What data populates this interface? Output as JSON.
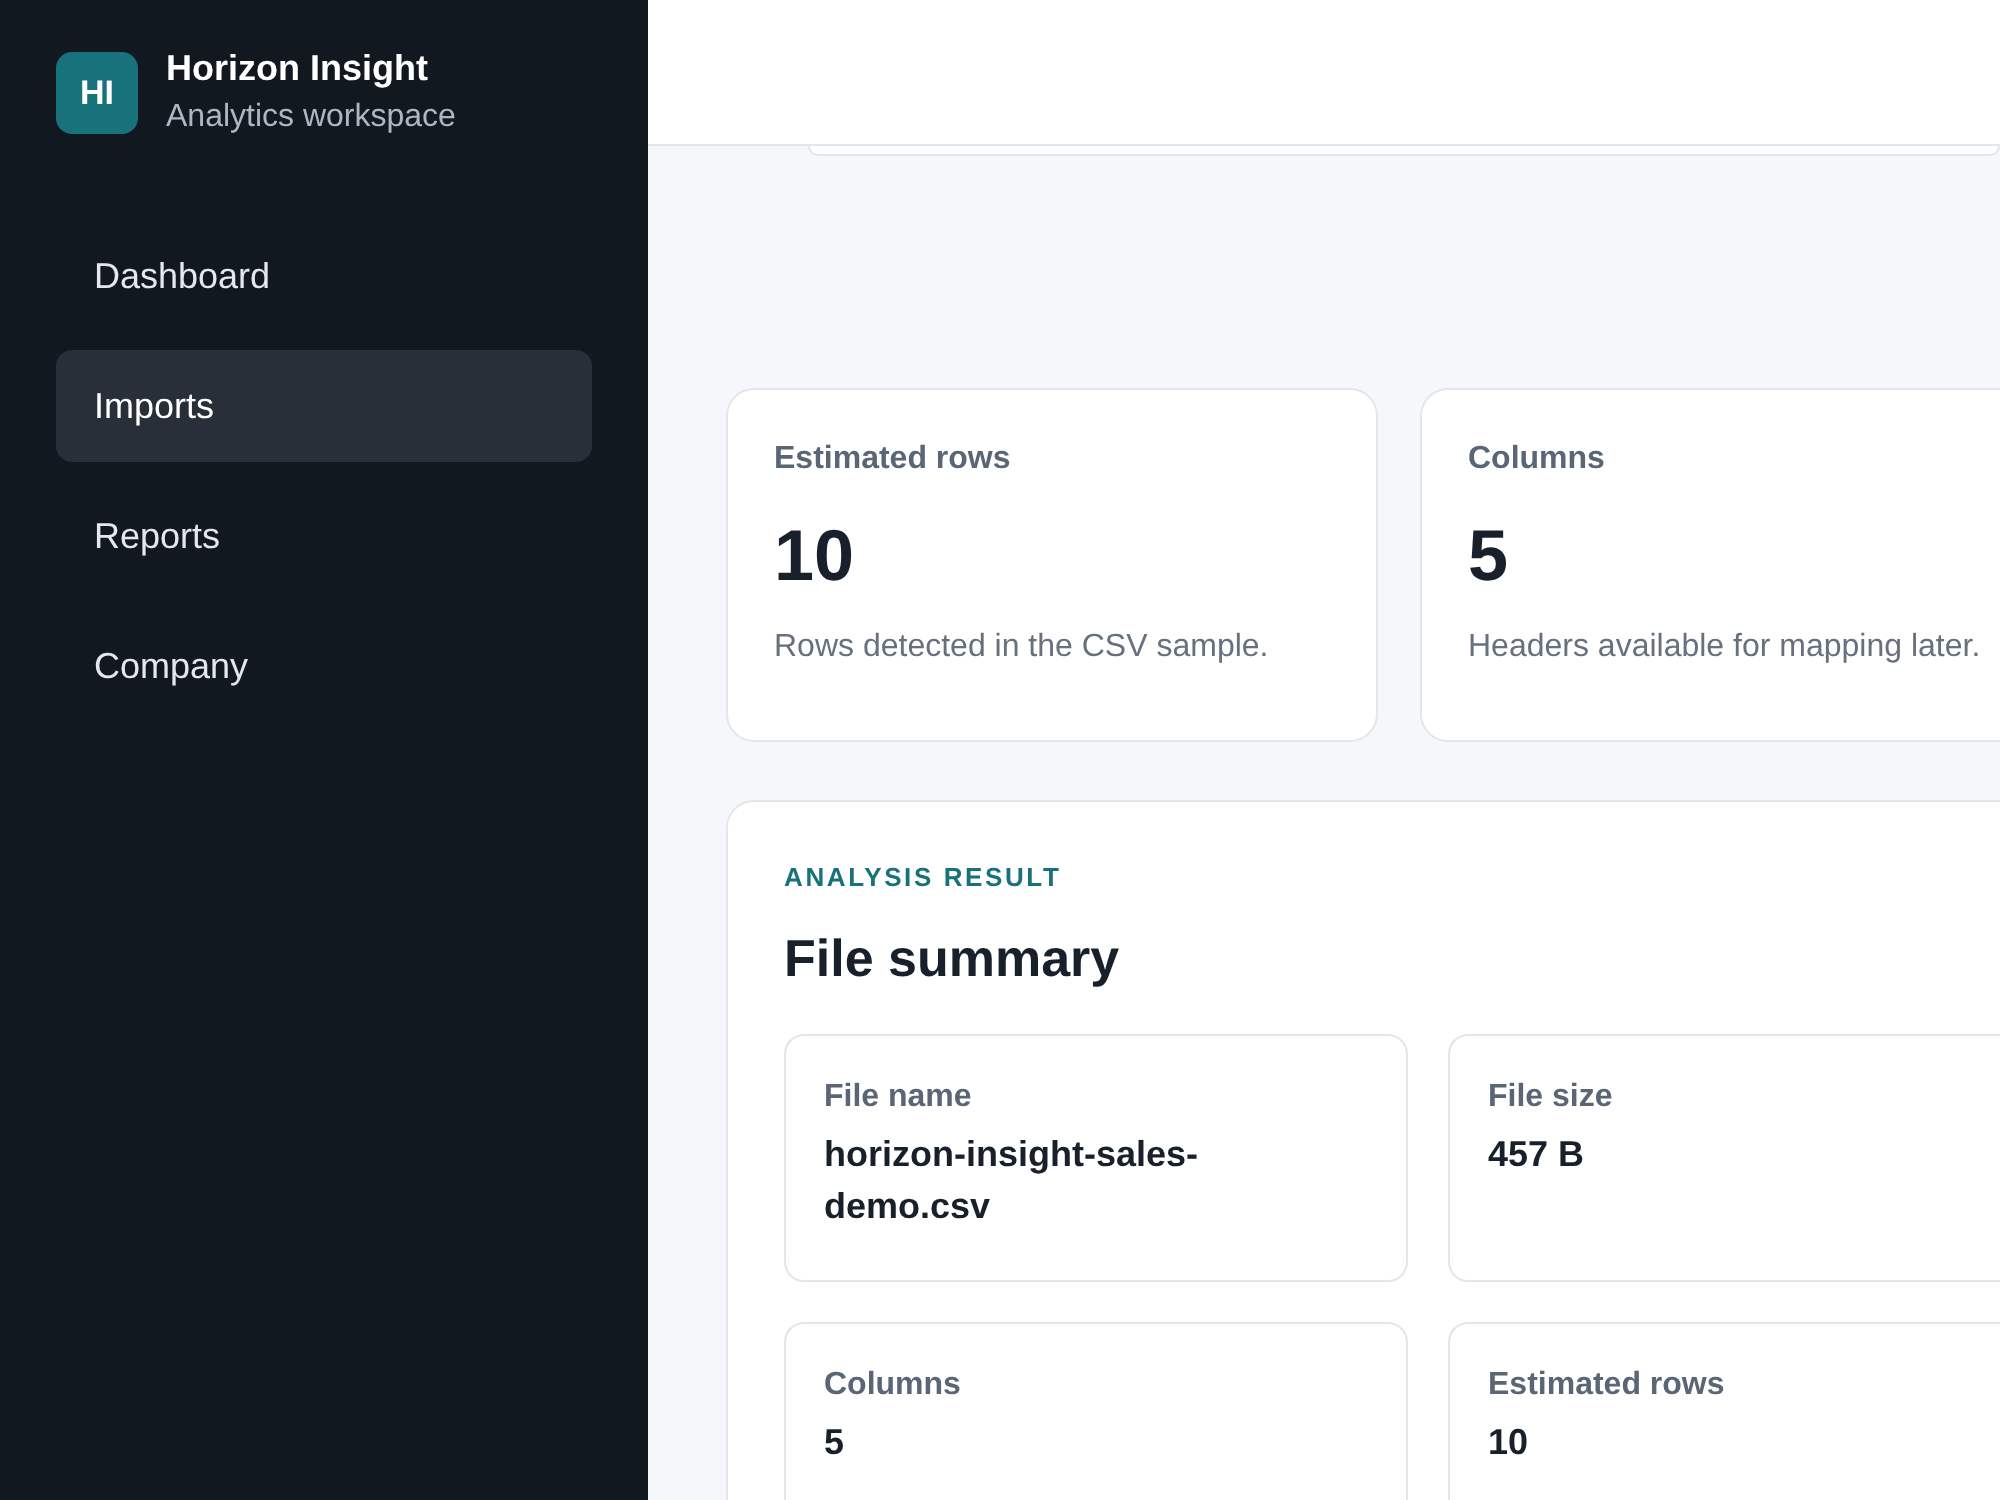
{
  "brand": {
    "logo": "HI",
    "name": "Horizon Insight",
    "subtitle": "Analytics workspace"
  },
  "nav": [
    {
      "label": "Dashboard",
      "selected": false
    },
    {
      "label": "Imports",
      "selected": true
    },
    {
      "label": "Reports",
      "selected": false
    },
    {
      "label": "Company",
      "selected": false
    }
  ],
  "stats": [
    {
      "label": "Estimated rows",
      "value": "10",
      "description": "Rows detected in the CSV sample."
    },
    {
      "label": "Columns",
      "value": "5",
      "description": "Headers available for mapping later."
    }
  ],
  "analysis": {
    "eyebrow": "ANALYSIS RESULT",
    "title": "File summary",
    "fields": [
      {
        "label": "File name",
        "value": "horizon-insight-sales-demo.csv"
      },
      {
        "label": "File size",
        "value": "457 B"
      },
      {
        "label": "Columns",
        "value": "5"
      },
      {
        "label": "Estimated rows",
        "value": "10"
      }
    ]
  }
}
